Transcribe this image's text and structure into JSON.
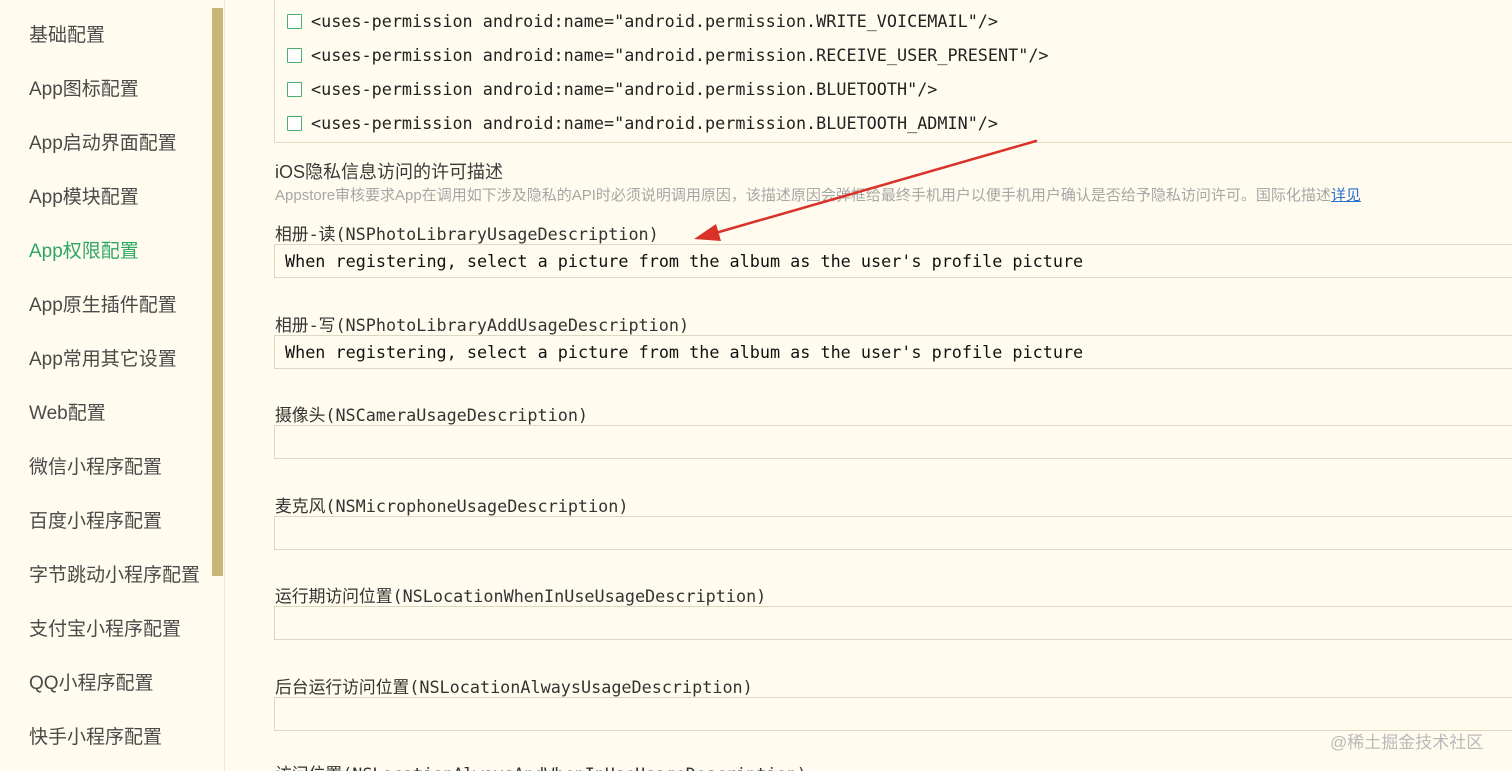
{
  "sidebar": {
    "items": [
      {
        "label": "基础配置",
        "active": false
      },
      {
        "label": "App图标配置",
        "active": false
      },
      {
        "label": "App启动界面配置",
        "active": false
      },
      {
        "label": "App模块配置",
        "active": false
      },
      {
        "label": "App权限配置",
        "active": true
      },
      {
        "label": "App原生插件配置",
        "active": false
      },
      {
        "label": "App常用其它设置",
        "active": false
      },
      {
        "label": "Web配置",
        "active": false
      },
      {
        "label": "微信小程序配置",
        "active": false
      },
      {
        "label": "百度小程序配置",
        "active": false
      },
      {
        "label": "字节跳动小程序配置",
        "active": false
      },
      {
        "label": "支付宝小程序配置",
        "active": false
      },
      {
        "label": "QQ小程序配置",
        "active": false
      },
      {
        "label": "快手小程序配置",
        "active": false
      }
    ]
  },
  "android_permissions": [
    {
      "text": "<uses-permission android:name=\"android.permission.WRITE_VOICEMAIL\"/>",
      "checked": false
    },
    {
      "text": "<uses-permission android:name=\"android.permission.RECEIVE_USER_PRESENT\"/>",
      "checked": false
    },
    {
      "text": "<uses-permission android:name=\"android.permission.BLUETOOTH\"/>",
      "checked": false
    },
    {
      "text": "<uses-permission android:name=\"android.permission.BLUETOOTH_ADMIN\"/>",
      "checked": false
    }
  ],
  "ios_section": {
    "title": "iOS隐私信息访问的许可描述",
    "description": "Appstore审核要求App在调用如下涉及隐私的API时必须说明调用原因，该描述原因会弹框给最终手机用户以便手机用户确认是否给予隐私访问许可。国际化描述",
    "link": "详见"
  },
  "fields": [
    {
      "label": "相册-读(NSPhotoLibraryUsageDescription)",
      "value": "When registering, select a picture from the album as the user's profile picture"
    },
    {
      "label": "相册-写(NSPhotoLibraryAddUsageDescription)",
      "value": "When registering, select a picture from the album as the user's profile picture"
    },
    {
      "label": "摄像头(NSCameraUsageDescription)",
      "value": ""
    },
    {
      "label": "麦克风(NSMicrophoneUsageDescription)",
      "value": ""
    },
    {
      "label": "运行期访问位置(NSLocationWhenInUseUsageDescription)",
      "value": ""
    },
    {
      "label": "后台运行访问位置(NSLocationAlwaysUsageDescription)",
      "value": ""
    },
    {
      "label": "访问位置(NSLocationAlwaysAndWhenInUseUsageDescription)",
      "value": ""
    }
  ],
  "watermark": "@稀土掘金技术社区",
  "colors": {
    "background": "#fffcef",
    "active": "#2ea663",
    "scrollbar": "#c8b678",
    "link": "#2b6fd1",
    "arrow": "#d9322a"
  }
}
